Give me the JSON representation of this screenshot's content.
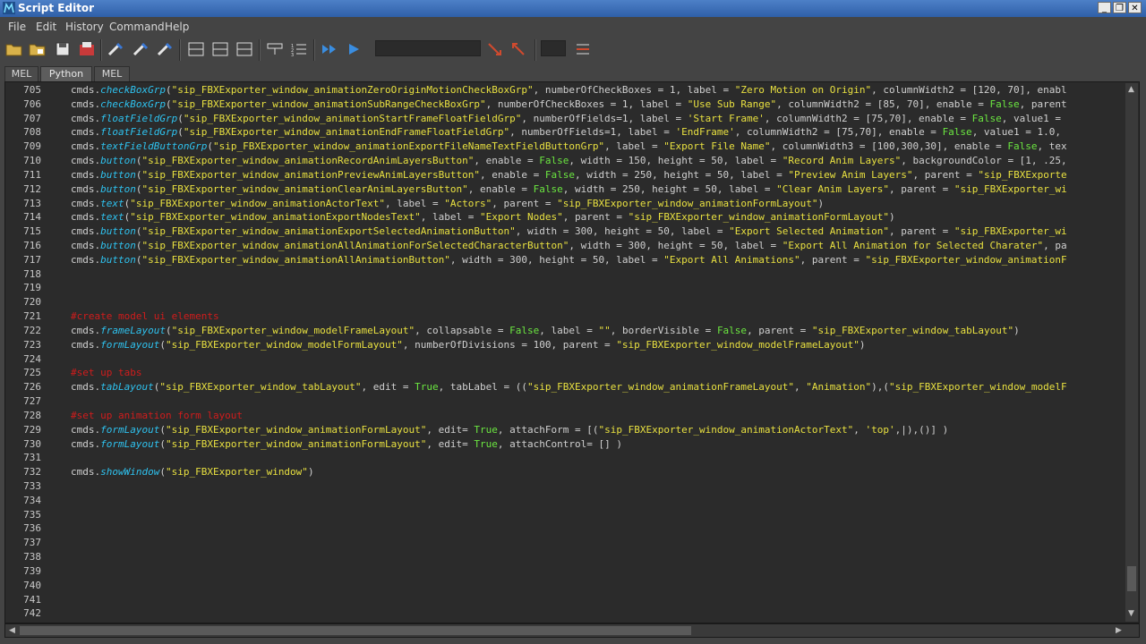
{
  "window": {
    "title": "Script Editor"
  },
  "menu": [
    "File",
    "Edit",
    "History",
    "Command",
    "Help"
  ],
  "tabs": [
    "MEL",
    "Python",
    "MEL"
  ],
  "active_tab": "Python",
  "lines": [
    {
      "n": "705",
      "segs": [
        [
          "cmd",
          "cmds."
        ],
        [
          "fn",
          "checkBoxGrp"
        ],
        [
          "cmd",
          "("
        ],
        [
          "str",
          "\"sip_FBXExporter_window_animationZeroOriginMotionCheckBoxGrp\""
        ],
        [
          "cmd",
          ", numberOfCheckBoxes = 1, label = "
        ],
        [
          "str",
          "\"Zero Motion on Origin\""
        ],
        [
          "cmd",
          ", columnWidth2 = [120, 70], enabl"
        ]
      ]
    },
    {
      "n": "706",
      "segs": [
        [
          "cmd",
          "cmds."
        ],
        [
          "fn",
          "checkBoxGrp"
        ],
        [
          "cmd",
          "("
        ],
        [
          "str",
          "\"sip_FBXExporter_window_animationSubRangeCheckBoxGrp\""
        ],
        [
          "cmd",
          ", numberOfCheckBoxes = 1, label = "
        ],
        [
          "str",
          "\"Use Sub Range\""
        ],
        [
          "cmd",
          ", columnWidth2 = [85, 70], enable = "
        ],
        [
          "kw",
          "False"
        ],
        [
          "cmd",
          ", parent"
        ]
      ]
    },
    {
      "n": "707",
      "segs": [
        [
          "cmd",
          "cmds."
        ],
        [
          "fn",
          "floatFieldGrp"
        ],
        [
          "cmd",
          "("
        ],
        [
          "str",
          "\"sip_FBXExporter_window_animationStartFrameFloatFieldGrp\""
        ],
        [
          "cmd",
          ", numberOfFields=1, label = "
        ],
        [
          "str",
          "'Start Frame'"
        ],
        [
          "cmd",
          ", columnWidth2 = [75,70], enable = "
        ],
        [
          "kw",
          "False"
        ],
        [
          "cmd",
          ", value1 ="
        ]
      ]
    },
    {
      "n": "708",
      "segs": [
        [
          "cmd",
          "cmds."
        ],
        [
          "fn",
          "floatFieldGrp"
        ],
        [
          "cmd",
          "("
        ],
        [
          "str",
          "\"sip_FBXExporter_window_animationEndFrameFloatFieldGrp\""
        ],
        [
          "cmd",
          ", numberOfFields=1, label = "
        ],
        [
          "str",
          "'EndFrame'"
        ],
        [
          "cmd",
          ", columnWidth2 = [75,70], enable = "
        ],
        [
          "kw",
          "False"
        ],
        [
          "cmd",
          ", value1 = 1.0,"
        ]
      ]
    },
    {
      "n": "709",
      "segs": [
        [
          "cmd",
          "cmds."
        ],
        [
          "fn",
          "textFieldButtonGrp"
        ],
        [
          "cmd",
          "("
        ],
        [
          "str",
          "\"sip_FBXExporter_window_animationExportFileNameTextFieldButtonGrp\""
        ],
        [
          "cmd",
          ", label = "
        ],
        [
          "str",
          "\"Export File Name\""
        ],
        [
          "cmd",
          ", columnWidth3 = [100,300,30], enable = "
        ],
        [
          "kw",
          "False"
        ],
        [
          "cmd",
          ", tex"
        ]
      ]
    },
    {
      "n": "710",
      "segs": [
        [
          "cmd",
          "cmds."
        ],
        [
          "fn",
          "button"
        ],
        [
          "cmd",
          "("
        ],
        [
          "str",
          "\"sip_FBXExporter_window_animationRecordAnimLayersButton\""
        ],
        [
          "cmd",
          ", enable = "
        ],
        [
          "kw",
          "False"
        ],
        [
          "cmd",
          ", width = 150, height = 50, label = "
        ],
        [
          "str",
          "\"Record Anim Layers\""
        ],
        [
          "cmd",
          ", backgroundColor = [1, .25,"
        ]
      ]
    },
    {
      "n": "711",
      "segs": [
        [
          "cmd",
          "cmds."
        ],
        [
          "fn",
          "button"
        ],
        [
          "cmd",
          "("
        ],
        [
          "str",
          "\"sip_FBXExporter_window_animationPreviewAnimLayersButton\""
        ],
        [
          "cmd",
          ", enable = "
        ],
        [
          "kw",
          "False"
        ],
        [
          "cmd",
          ", width = 250, height = 50, label = "
        ],
        [
          "str",
          "\"Preview Anim Layers\""
        ],
        [
          "cmd",
          ", parent = "
        ],
        [
          "str",
          "\"sip_FBXExporte"
        ]
      ]
    },
    {
      "n": "712",
      "segs": [
        [
          "cmd",
          "cmds."
        ],
        [
          "fn",
          "button"
        ],
        [
          "cmd",
          "("
        ],
        [
          "str",
          "\"sip_FBXExporter_window_animationClearAnimLayersButton\""
        ],
        [
          "cmd",
          ", enable = "
        ],
        [
          "kw",
          "False"
        ],
        [
          "cmd",
          ", width = 250, height = 50, label = "
        ],
        [
          "str",
          "\"Clear Anim Layers\""
        ],
        [
          "cmd",
          ", parent = "
        ],
        [
          "str",
          "\"sip_FBXExporter_wi"
        ]
      ]
    },
    {
      "n": "713",
      "segs": [
        [
          "cmd",
          "cmds."
        ],
        [
          "fn",
          "text"
        ],
        [
          "cmd",
          "("
        ],
        [
          "str",
          "\"sip_FBXExporter_window_animationActorText\""
        ],
        [
          "cmd",
          ", label = "
        ],
        [
          "str",
          "\"Actors\""
        ],
        [
          "cmd",
          ", parent = "
        ],
        [
          "str",
          "\"sip_FBXExporter_window_animationFormLayout\""
        ],
        [
          "cmd",
          ")"
        ]
      ]
    },
    {
      "n": "714",
      "segs": [
        [
          "cmd",
          "cmds."
        ],
        [
          "fn",
          "text"
        ],
        [
          "cmd",
          "("
        ],
        [
          "str",
          "\"sip_FBXExporter_window_animationExportNodesText\""
        ],
        [
          "cmd",
          ", label = "
        ],
        [
          "str",
          "\"Export Nodes\""
        ],
        [
          "cmd",
          ", parent = "
        ],
        [
          "str",
          "\"sip_FBXExporter_window_animationFormLayout\""
        ],
        [
          "cmd",
          ")"
        ]
      ]
    },
    {
      "n": "715",
      "segs": [
        [
          "cmd",
          "cmds."
        ],
        [
          "fn",
          "button"
        ],
        [
          "cmd",
          "("
        ],
        [
          "str",
          "\"sip_FBXExporter_window_animationExportSelectedAnimationButton\""
        ],
        [
          "cmd",
          ", width = 300, height = 50, label = "
        ],
        [
          "str",
          "\"Export Selected Animation\""
        ],
        [
          "cmd",
          ", parent = "
        ],
        [
          "str",
          "\"sip_FBXExporter_wi"
        ]
      ]
    },
    {
      "n": "716",
      "segs": [
        [
          "cmd",
          "cmds."
        ],
        [
          "fn",
          "button"
        ],
        [
          "cmd",
          "("
        ],
        [
          "str",
          "\"sip_FBXExporter_window_animationAllAnimationForSelectedCharacterButton\""
        ],
        [
          "cmd",
          ", width = 300, height = 50, label = "
        ],
        [
          "str",
          "\"Export All Animation for Selected Charater\""
        ],
        [
          "cmd",
          ", pa"
        ]
      ]
    },
    {
      "n": "717",
      "segs": [
        [
          "cmd",
          "cmds."
        ],
        [
          "fn",
          "button"
        ],
        [
          "cmd",
          "("
        ],
        [
          "str",
          "\"sip_FBXExporter_window_animationAllAnimationButton\""
        ],
        [
          "cmd",
          ", width = 300, height = 50, label = "
        ],
        [
          "str",
          "\"Export All Animations\""
        ],
        [
          "cmd",
          ", parent = "
        ],
        [
          "str",
          "\"sip_FBXExporter_window_animationF"
        ]
      ]
    },
    {
      "n": "718",
      "segs": []
    },
    {
      "n": "719",
      "segs": []
    },
    {
      "n": "720",
      "segs": []
    },
    {
      "n": "721",
      "segs": [
        [
          "cm",
          "#create model ui elements"
        ]
      ]
    },
    {
      "n": "722",
      "segs": [
        [
          "cmd",
          "cmds."
        ],
        [
          "fn",
          "frameLayout"
        ],
        [
          "cmd",
          "("
        ],
        [
          "str",
          "\"sip_FBXExporter_window_modelFrameLayout\""
        ],
        [
          "cmd",
          ", collapsable = "
        ],
        [
          "kw",
          "False"
        ],
        [
          "cmd",
          ", label = "
        ],
        [
          "str",
          "\"\""
        ],
        [
          "cmd",
          ", borderVisible = "
        ],
        [
          "kw",
          "False"
        ],
        [
          "cmd",
          ", parent = "
        ],
        [
          "str",
          "\"sip_FBXExporter_window_tabLayout\""
        ],
        [
          "cmd",
          ")"
        ]
      ]
    },
    {
      "n": "723",
      "segs": [
        [
          "cmd",
          "cmds."
        ],
        [
          "fn",
          "formLayout"
        ],
        [
          "cmd",
          "("
        ],
        [
          "str",
          "\"sip_FBXExporter_window_modelFormLayout\""
        ],
        [
          "cmd",
          ", numberOfDivisions = 100, parent = "
        ],
        [
          "str",
          "\"sip_FBXExporter_window_modelFrameLayout\""
        ],
        [
          "cmd",
          ")"
        ]
      ]
    },
    {
      "n": "724",
      "segs": []
    },
    {
      "n": "725",
      "segs": [
        [
          "cm",
          "#set up tabs"
        ]
      ]
    },
    {
      "n": "726",
      "segs": [
        [
          "cmd",
          "cmds."
        ],
        [
          "fn",
          "tabLayout"
        ],
        [
          "cmd",
          "("
        ],
        [
          "str",
          "\"sip_FBXExporter_window_tabLayout\""
        ],
        [
          "cmd",
          ", edit = "
        ],
        [
          "kw",
          "True"
        ],
        [
          "cmd",
          ", tabLabel = (("
        ],
        [
          "str",
          "\"sip_FBXExporter_window_animationFrameLayout\""
        ],
        [
          "cmd",
          ", "
        ],
        [
          "str",
          "\"Animation\""
        ],
        [
          "cmd",
          "),("
        ],
        [
          "str",
          "\"sip_FBXExporter_window_modelF"
        ]
      ]
    },
    {
      "n": "727",
      "segs": []
    },
    {
      "n": "728",
      "segs": [
        [
          "cm",
          "#set up animation form layout"
        ]
      ]
    },
    {
      "n": "729",
      "segs": [
        [
          "cmd",
          "cmds."
        ],
        [
          "fn",
          "formLayout"
        ],
        [
          "cmd",
          "("
        ],
        [
          "str",
          "\"sip_FBXExporter_window_animationFormLayout\""
        ],
        [
          "cmd",
          ", edit= "
        ],
        [
          "kw",
          "True"
        ],
        [
          "cmd",
          ", attachForm = [("
        ],
        [
          "str",
          "\"sip_FBXExporter_window_animationActorText\""
        ],
        [
          "cmd",
          ", "
        ],
        [
          "str",
          "'top'"
        ],
        [
          "cmd",
          ",|),()] )"
        ]
      ]
    },
    {
      "n": "730",
      "segs": [
        [
          "cmd",
          "cmds."
        ],
        [
          "fn",
          "formLayout"
        ],
        [
          "cmd",
          "("
        ],
        [
          "str",
          "\"sip_FBXExporter_window_animationFormLayout\""
        ],
        [
          "cmd",
          ", edit= "
        ],
        [
          "kw",
          "True"
        ],
        [
          "cmd",
          ", attachControl= [] )"
        ]
      ]
    },
    {
      "n": "731",
      "segs": []
    },
    {
      "n": "732",
      "segs": [
        [
          "cmd",
          "cmds."
        ],
        [
          "fn",
          "showWindow"
        ],
        [
          "cmd",
          "("
        ],
        [
          "str",
          "\"sip_FBXExporter_window\""
        ],
        [
          "cmd",
          ")"
        ]
      ]
    },
    {
      "n": "733",
      "segs": []
    },
    {
      "n": "734",
      "segs": []
    },
    {
      "n": "735",
      "segs": []
    },
    {
      "n": "736",
      "segs": []
    },
    {
      "n": "737",
      "segs": []
    },
    {
      "n": "738",
      "segs": []
    },
    {
      "n": "739",
      "segs": []
    },
    {
      "n": "740",
      "segs": []
    },
    {
      "n": "741",
      "segs": []
    },
    {
      "n": "742",
      "segs": []
    },
    {
      "n": "743",
      "segs": []
    }
  ]
}
